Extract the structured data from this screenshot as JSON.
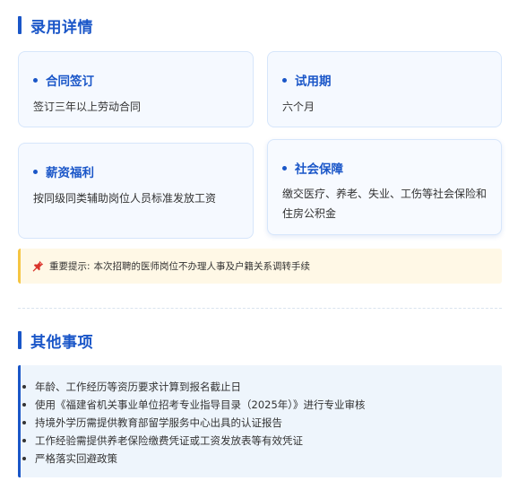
{
  "employment": {
    "title": "录用详情",
    "cards": [
      {
        "title": "合同签订",
        "body": "签订三年以上劳动合同"
      },
      {
        "title": "试用期",
        "body": "六个月"
      },
      {
        "title": "薪资福利",
        "body": "按同级同类辅助岗位人员标准发放工资"
      },
      {
        "title": "社会保障",
        "body": "缴交医疗、养老、失业、工伤等社会保险和住房公积金"
      }
    ],
    "notice": {
      "icon": "pushpin-icon",
      "label": "重要提示:",
      "text": "本次招聘的医师岗位不办理人事及户籍关系调转手续"
    }
  },
  "other": {
    "title": "其他事项",
    "items": [
      "年龄、工作经历等资历要求计算到报名截止日",
      "使用《福建省机关事业单位招考专业指导目录（2025年）》进行专业审核",
      "持境外学历需提供教育部留学服务中心出具的认证报告",
      "工作经验需提供养老保险缴费凭证或工资发放表等有效凭证",
      "严格落实回避政策"
    ]
  },
  "colors": {
    "accent": "#1a56c8",
    "card_bg": "#f5f9ff",
    "notice_bg": "#fff8e6",
    "notice_border": "#f5c542"
  }
}
